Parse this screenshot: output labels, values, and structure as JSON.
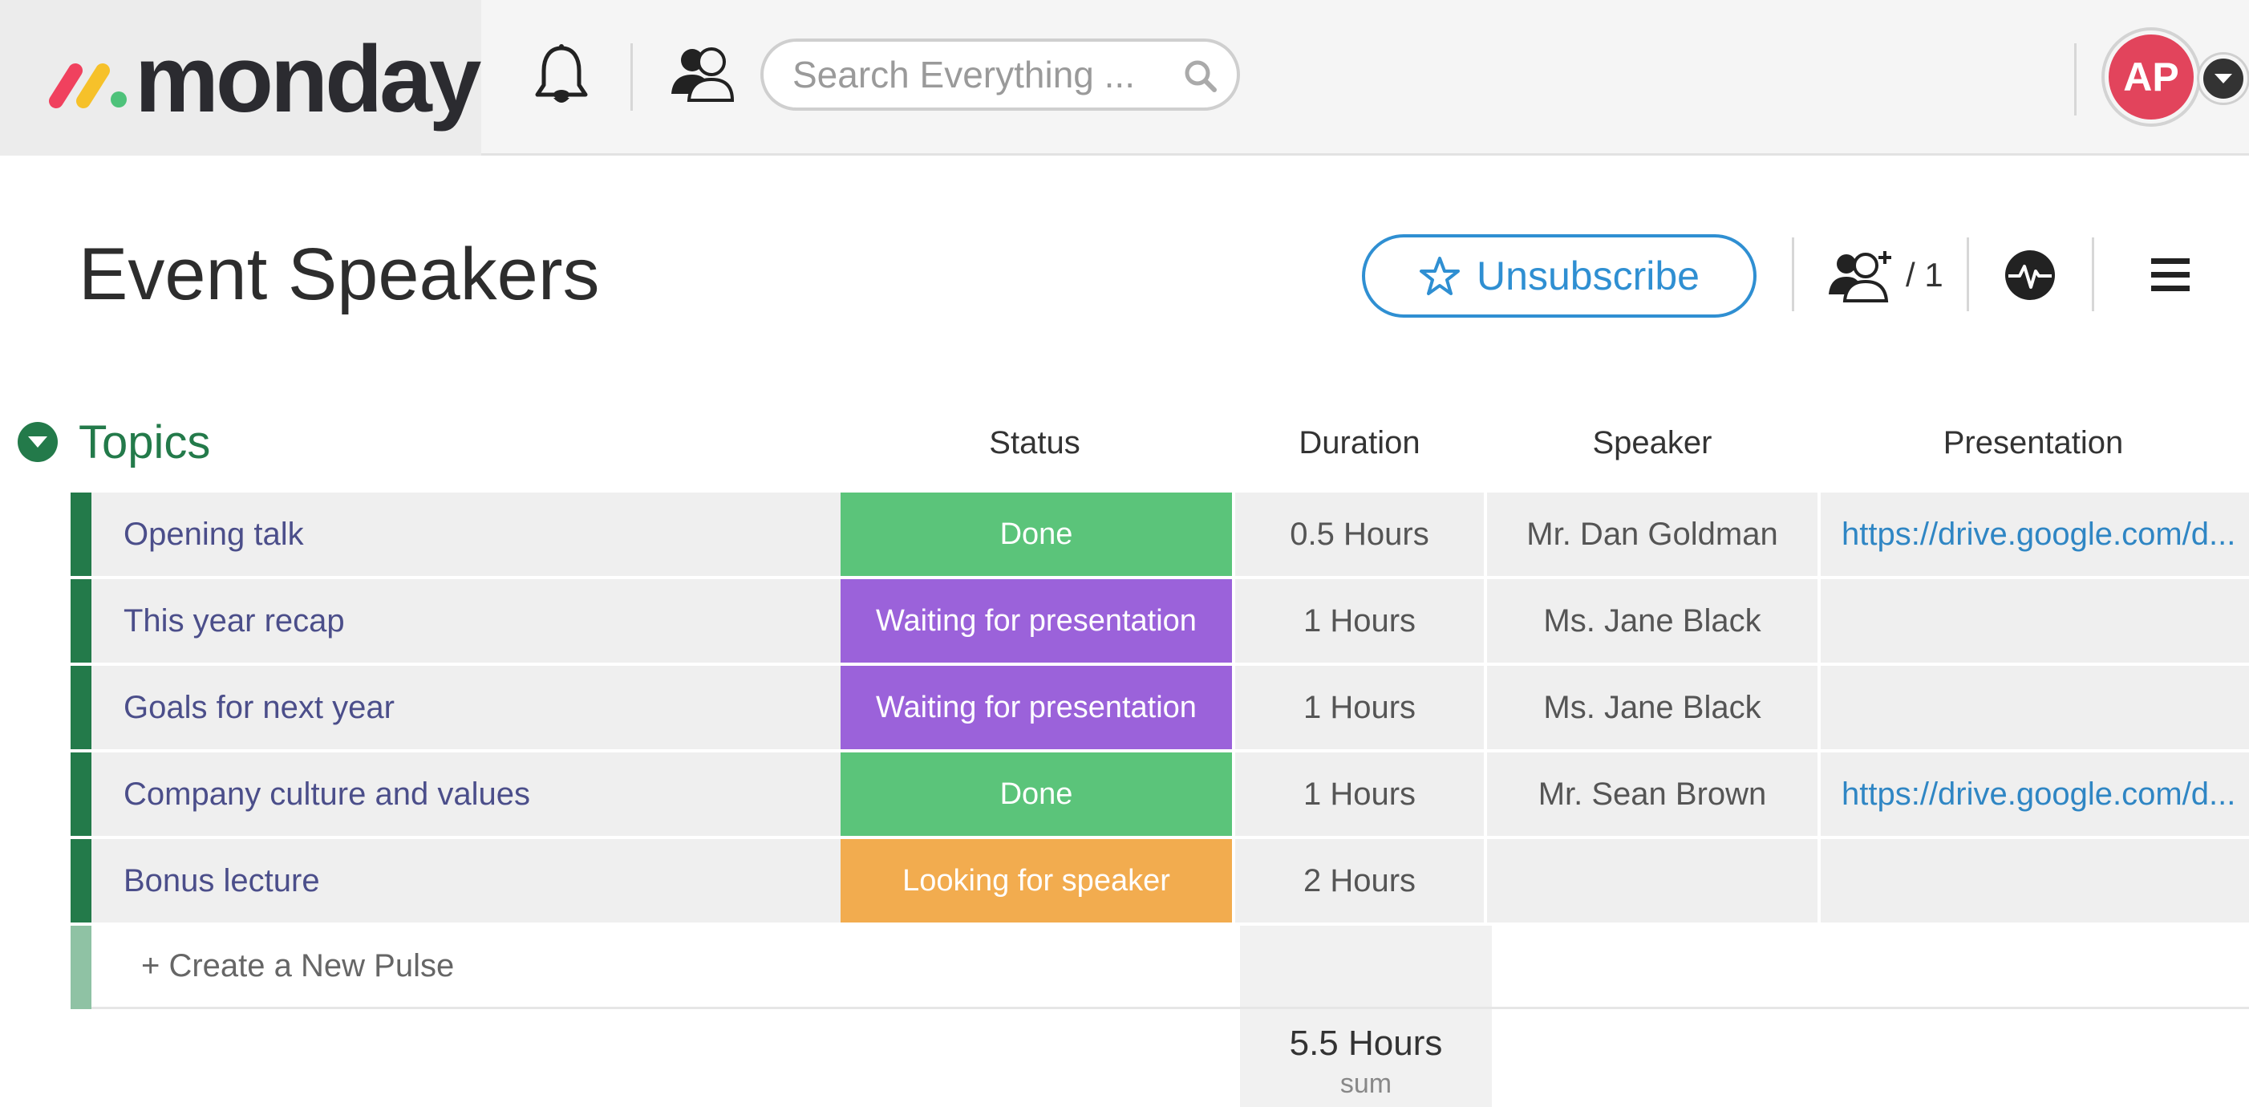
{
  "app": {
    "logo_text": "monday",
    "search_placeholder": "Search Everything ...",
    "user_initials": "AP",
    "avatar_color": "#e2445c"
  },
  "board": {
    "title": "Event Speakers",
    "unsubscribe_label": "Unsubscribe",
    "members_count": "/ 1"
  },
  "group": {
    "title": "Topics",
    "color": "#237a4a",
    "columns": [
      "Status",
      "Duration",
      "Speaker",
      "Presentation"
    ],
    "rows": [
      {
        "name": "Opening talk",
        "status": "Done",
        "status_color": "#5bc47a",
        "duration": "0.5 Hours",
        "speaker": "Mr. Dan Goldman",
        "presentation": "https://drive.google.com/d..."
      },
      {
        "name": "This year recap",
        "status": "Waiting for presentation",
        "status_color": "#9b62da",
        "duration": "1 Hours",
        "speaker": "Ms. Jane Black",
        "presentation": ""
      },
      {
        "name": "Goals for next year",
        "status": "Waiting for presentation",
        "status_color": "#9b62da",
        "duration": "1 Hours",
        "speaker": "Ms. Jane Black",
        "presentation": ""
      },
      {
        "name": "Company culture and values",
        "status": "Done",
        "status_color": "#5bc47a",
        "duration": "1 Hours",
        "speaker": "Mr. Sean Brown",
        "presentation": "https://drive.google.com/d..."
      },
      {
        "name": "Bonus lecture",
        "status": "Looking for speaker",
        "status_color": "#f2ac4f",
        "duration": "2 Hours",
        "speaker": "",
        "presentation": ""
      }
    ],
    "create_label": "+ Create a New Pulse",
    "sum_value": "5.5 Hours",
    "sum_label": "sum"
  },
  "icons": {
    "bell": "bell-icon",
    "people": "people-icon",
    "search": "search-icon",
    "star": "star-icon",
    "members": "add-member-icon",
    "activity": "activity-icon",
    "menu": "hamburger-menu-icon",
    "toggle": "chevron-down-icon",
    "caret": "caret-down-icon"
  }
}
